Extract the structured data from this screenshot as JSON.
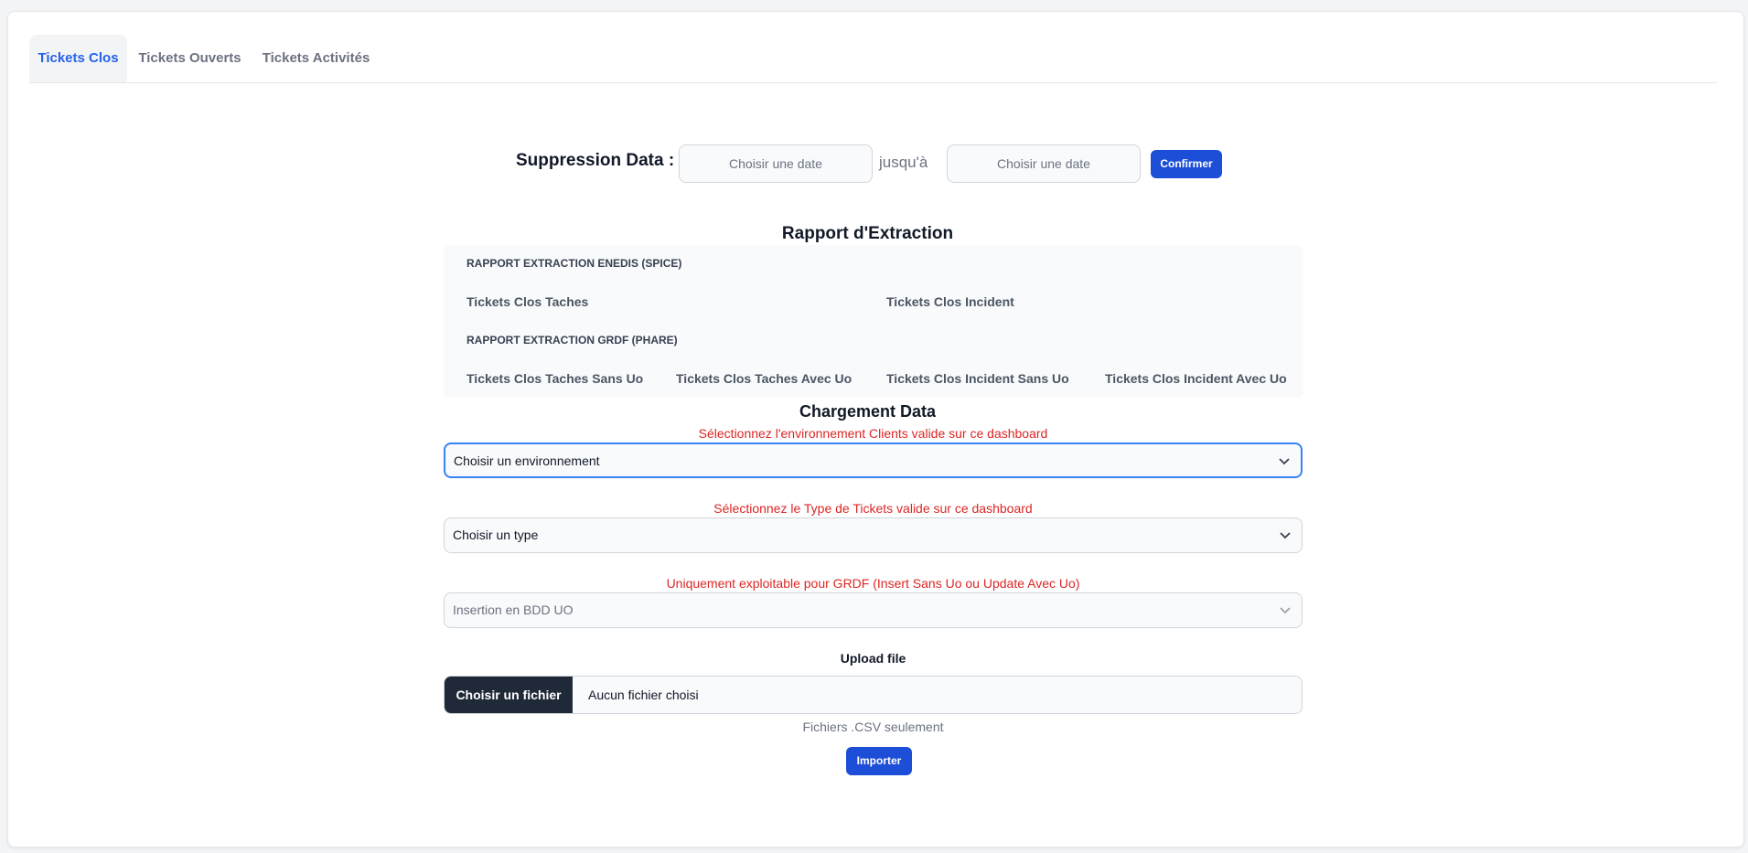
{
  "tabs": [
    {
      "label": "Tickets Clos",
      "active": true
    },
    {
      "label": "Tickets Ouverts",
      "active": false
    },
    {
      "label": "Tickets Activités",
      "active": false
    }
  ],
  "suppression": {
    "label": "Suppression Data :",
    "date_from_placeholder": "Choisir une date",
    "separator": "jusqu'à",
    "date_to_placeholder": "Choisir une date",
    "confirm_label": "Confirmer"
  },
  "report": {
    "title": "Rapport d'Extraction",
    "enedis_heading": "RAPPORT EXTRACTION ENEDIS (SPICE)",
    "enedis_links": [
      "Tickets Clos Taches",
      "Tickets Clos Incident"
    ],
    "grdf_heading": "RAPPORT EXTRACTION GRDF (PHARE)",
    "grdf_links": [
      "Tickets Clos Taches Sans Uo",
      "Tickets Clos Taches Avec Uo",
      "Tickets Clos Incident Sans Uo",
      "Tickets Clos Incident Avec Uo"
    ]
  },
  "loading": {
    "title": "Chargement Data",
    "env_hint": "Sélectionnez l'environnement Clients valide sur ce dashboard",
    "env_select": "Choisir un environnement",
    "type_hint": "Sélectionnez le Type de Tickets valide sur ce dashboard",
    "type_select": "Choisir un type",
    "grdf_hint": "Uniquement exploitable pour GRDF (Insert Sans Uo ou Update Avec Uo)",
    "grdf_select": "Insertion en BDD UO",
    "upload_label": "Upload file",
    "file_button": "Choisir un fichier",
    "file_name": "Aucun fichier choisi",
    "csv_note": "Fichiers .CSV seulement",
    "import_label": "Importer"
  },
  "colors": {
    "accent": "#1d4ed8",
    "hint": "#dc2626",
    "dark_button": "#1f2937"
  }
}
